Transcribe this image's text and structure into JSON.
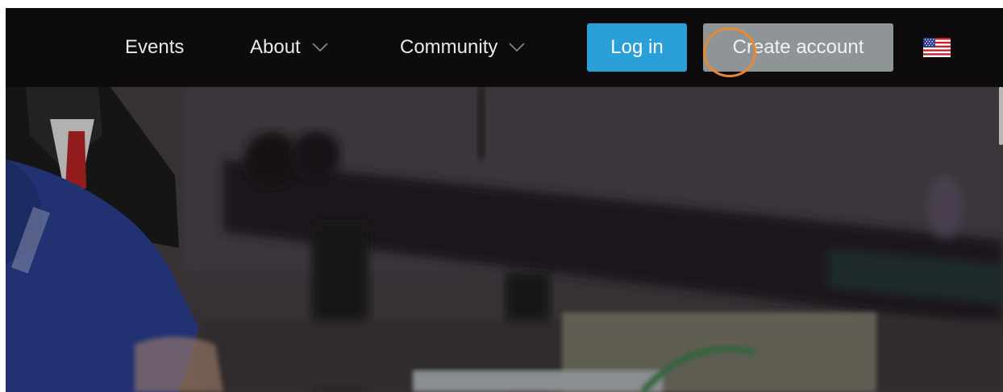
{
  "nav": {
    "items": [
      {
        "label": "Events",
        "has_dropdown": false
      },
      {
        "label": "About",
        "has_dropdown": true
      },
      {
        "label": "Community",
        "has_dropdown": true
      }
    ],
    "login_label": "Log in",
    "create_account_label": "Create account",
    "language_icon": "us-flag-icon"
  },
  "colors": {
    "nav_background": "#0d0b0b",
    "login_button": "#2a9fd8",
    "create_account_button": "#8f9496",
    "click_indicator": "#e8892f"
  }
}
